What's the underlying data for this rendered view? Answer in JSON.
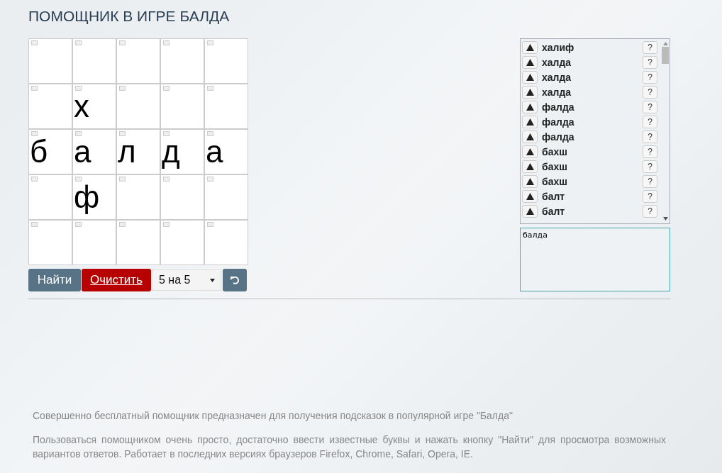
{
  "title": "ПОМОЩНИК В ИГРЕ БАЛДА",
  "grid": [
    [
      {
        "kind": "blank"
      },
      {
        "kind": "blank"
      },
      {
        "kind": "blank"
      },
      {
        "kind": "blank"
      },
      {
        "kind": "blank"
      }
    ],
    [
      {
        "kind": "blank"
      },
      {
        "kind": "letter",
        "letter": "х"
      },
      {
        "kind": "blank"
      },
      {
        "kind": "blank"
      },
      {
        "kind": "blank"
      }
    ],
    [
      {
        "kind": "letter",
        "letter": "б"
      },
      {
        "kind": "letter",
        "letter": "а"
      },
      {
        "kind": "letter",
        "letter": "л"
      },
      {
        "kind": "letter",
        "letter": "д"
      },
      {
        "kind": "letter",
        "letter": "а"
      }
    ],
    [
      {
        "kind": "blank"
      },
      {
        "kind": "letter",
        "letter": "ф"
      },
      {
        "kind": "blank"
      },
      {
        "kind": "blank"
      },
      {
        "kind": "blank"
      }
    ],
    [
      {
        "kind": "blank"
      },
      {
        "kind": "blank"
      },
      {
        "kind": "blank"
      },
      {
        "kind": "blank"
      },
      {
        "kind": "blank"
      }
    ]
  ],
  "buttons": {
    "find": "Найти",
    "clear": "Очистить"
  },
  "size_select": {
    "value": "5 на 5"
  },
  "words": [
    {
      "word": "халиф",
      "hint": "?"
    },
    {
      "word": "халда",
      "hint": "?"
    },
    {
      "word": "халда",
      "hint": "?"
    },
    {
      "word": "халда",
      "hint": "?"
    },
    {
      "word": "фалда",
      "hint": "?"
    },
    {
      "word": "фалда",
      "hint": "?"
    },
    {
      "word": "фалда",
      "hint": "?"
    },
    {
      "word": "бахш",
      "hint": "?"
    },
    {
      "word": "бахш",
      "hint": "?"
    },
    {
      "word": "бахш",
      "hint": "?"
    },
    {
      "word": "балт",
      "hint": "?"
    },
    {
      "word": "балт",
      "hint": "?"
    }
  ],
  "notes": {
    "value": "балда"
  },
  "footer": [
    "Совершенно бесплатный помощник предназначен для получения подсказок в популярной игре \"Балда\"",
    "Пользоваться помощником очень просто, достаточно ввести известные буквы и нажать кнопку \"Найти\" для просмотра возможных вариантов ответов. Работает в последних версиях браузеров Firefox, Chrome, Safari, Opera, IE."
  ]
}
